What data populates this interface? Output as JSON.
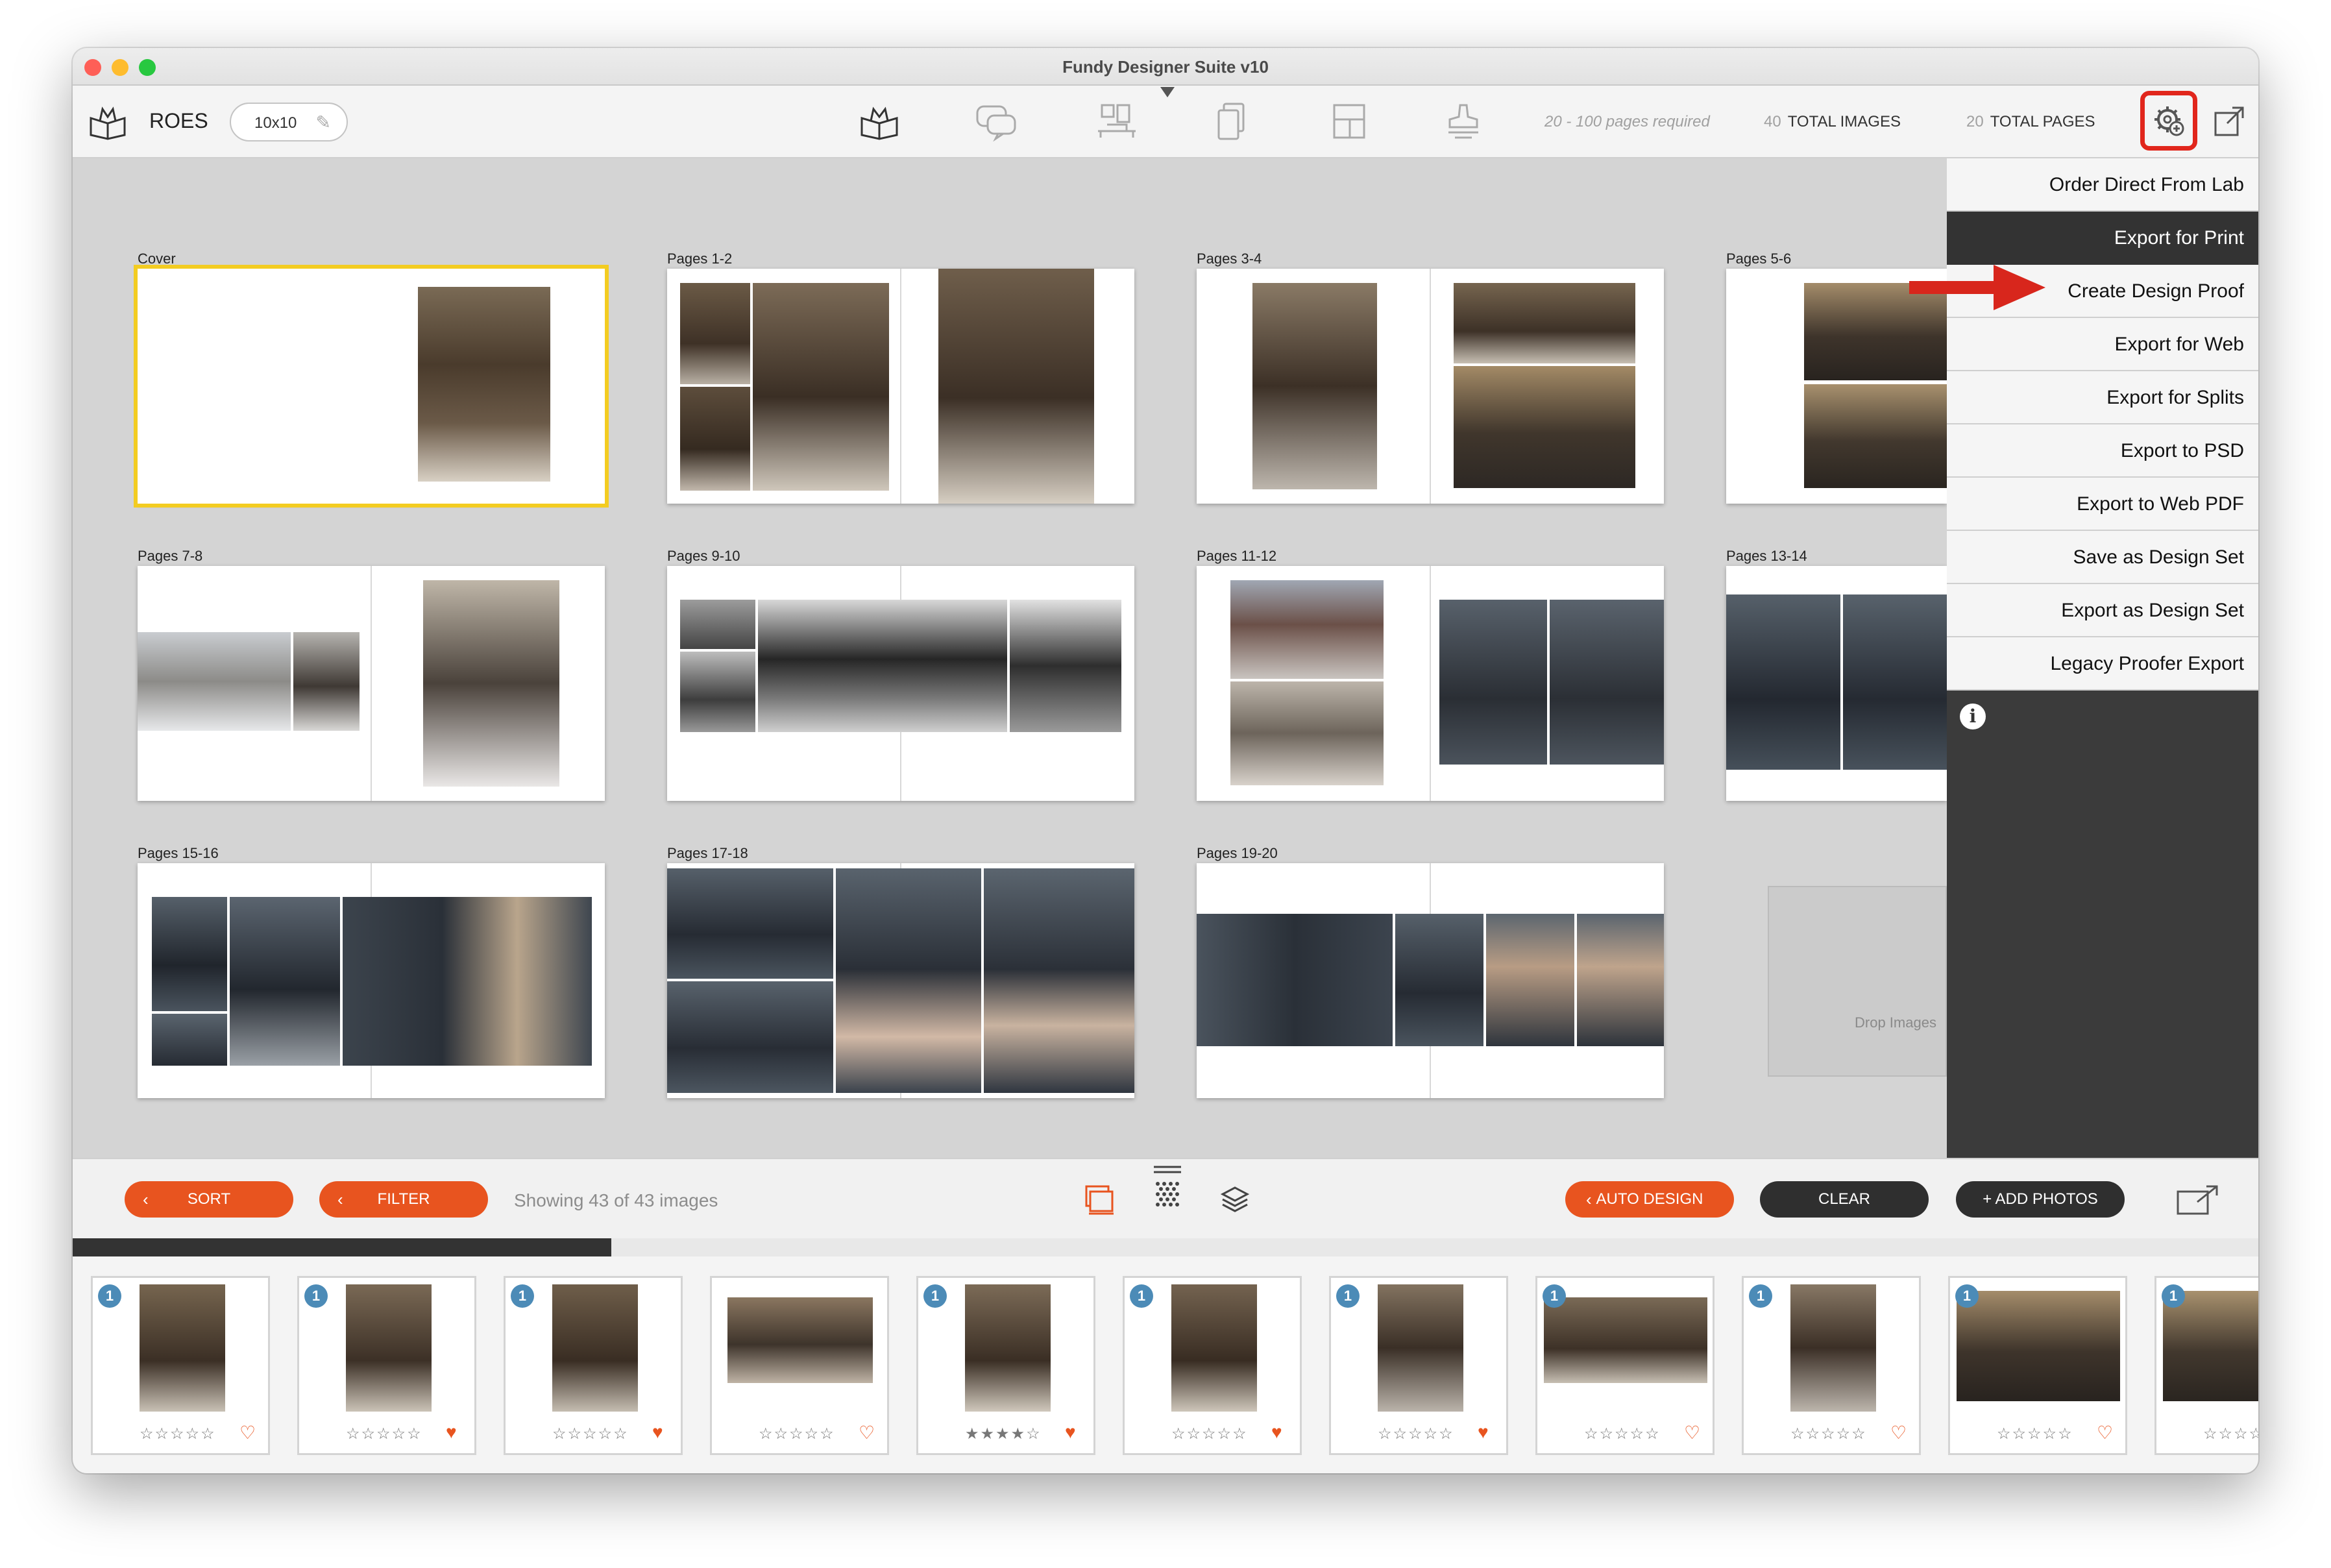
{
  "window": {
    "title": "Fundy Designer Suite v10"
  },
  "toolbar": {
    "roes_label": "ROES",
    "size_label": "10x10",
    "pages_required": "20 - 100 pages required",
    "total_images_count": "40",
    "total_images_label": "TOTAL IMAGES",
    "total_pages_count": "20",
    "total_pages_label": "TOTAL PAGES"
  },
  "spreads": [
    {
      "label": "Cover"
    },
    {
      "label": "Pages 1-2"
    },
    {
      "label": "Pages 3-4"
    },
    {
      "label": "Pages 5-6"
    },
    {
      "label": "Pages 7-8"
    },
    {
      "label": "Pages 9-10"
    },
    {
      "label": "Pages 11-12"
    },
    {
      "label": "Pages 13-14"
    },
    {
      "label": "Pages 15-16"
    },
    {
      "label": "Pages 17-18"
    },
    {
      "label": "Pages 19-20"
    }
  ],
  "drop_zone": {
    "label": "Drop Images"
  },
  "export_menu": {
    "items": [
      {
        "label": "Order Direct From Lab"
      },
      {
        "label": "Export for Print"
      },
      {
        "label": "Create Design Proof"
      },
      {
        "label": "Export for Web"
      },
      {
        "label": "Export for Splits"
      },
      {
        "label": "Export to PSD"
      },
      {
        "label": "Export to Web PDF"
      },
      {
        "label": "Save as Design Set"
      },
      {
        "label": "Export as Design Set"
      },
      {
        "label": "Legacy Proofer Export"
      }
    ],
    "info_glyph": "i"
  },
  "bottombar": {
    "sort_label": "SORT",
    "filter_label": "FILTER",
    "showing_text": "Showing 43 of 43 images",
    "auto_design_label": "AUTO DESIGN",
    "clear_label": "CLEAR",
    "add_photos_label": "+ ADD PHOTOS"
  },
  "filmstrip": {
    "thumbs": [
      {
        "badge": "1",
        "rating": 0,
        "favorite": false
      },
      {
        "badge": "1",
        "rating": 0,
        "favorite": true
      },
      {
        "badge": "1",
        "rating": 0,
        "favorite": true
      },
      {
        "badge": "",
        "rating": 0,
        "favorite": false
      },
      {
        "badge": "1",
        "rating": 4,
        "favorite": true
      },
      {
        "badge": "1",
        "rating": 0,
        "favorite": true
      },
      {
        "badge": "1",
        "rating": 0,
        "favorite": true
      },
      {
        "badge": "1",
        "rating": 0,
        "favorite": false
      },
      {
        "badge": "1",
        "rating": 0,
        "favorite": false
      },
      {
        "badge": "1",
        "rating": 0,
        "favorite": false
      },
      {
        "badge": "1",
        "rating": 0,
        "favorite": false
      }
    ]
  },
  "colors": {
    "accent_orange": "#e8541f",
    "highlight_red": "#e1261c",
    "selection_yellow": "#f3cc21",
    "badge_blue": "#4c8bb7"
  }
}
